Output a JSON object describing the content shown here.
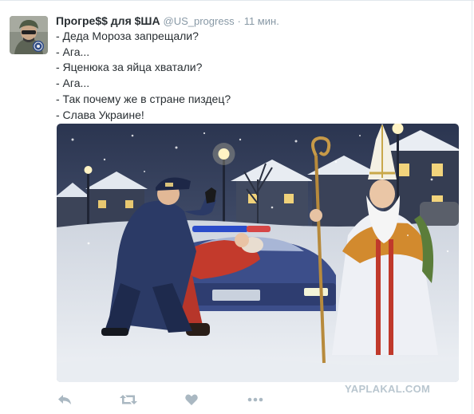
{
  "tweet": {
    "author_name": "Прогре$$ для $ША",
    "handle": "@US_progress",
    "separator": "·",
    "time": "11 мин.",
    "lines": [
      "- Деда Мороза запрещали?",
      "- Ага...",
      "- Яценюка за яйца хватали?",
      "- Ага...",
      "- Так почему же в стране пиздец?",
      "- Слава Украине!"
    ]
  },
  "actions": [
    "reply-icon",
    "retweet-icon",
    "like-icon",
    "more-icon"
  ],
  "watermark": "YAPLAKAL.COM",
  "colors": {
    "text": "#292f33",
    "muted": "#8899a6",
    "icon": "#aab8c2",
    "watermark": "#b9c6cf"
  }
}
